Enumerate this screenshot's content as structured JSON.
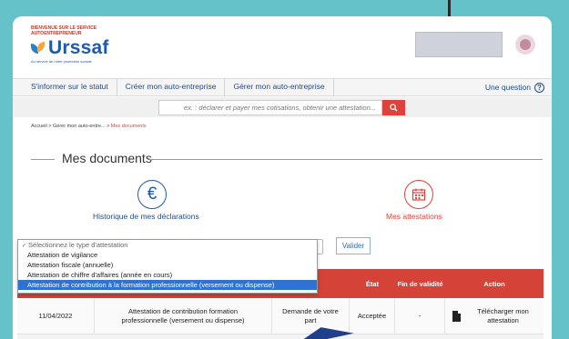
{
  "brand": {
    "small_text": "BIENVENUE SUR LE SERVICE AUTOENTREPRENEUR",
    "name": "Urssaf",
    "tagline": "Au service de notre protection sociale"
  },
  "nav": {
    "items": [
      "S'informer sur le statut",
      "Créer mon auto-entreprise",
      "Gérer mon auto-entreprise"
    ],
    "question": "Une question"
  },
  "search": {
    "placeholder": "ex. : déclarer et payer mes cotisations, obtenir une attestation..."
  },
  "breadcrumb": {
    "items": [
      "Accueil",
      "Gérer mon auto-entre...",
      "Mes documents"
    ]
  },
  "page_title": "Mes documents",
  "cards": {
    "history": "Historique de mes déclarations",
    "attestations": "Mes attestations"
  },
  "dropdown": {
    "placeholder": "Sélectionnez le type d'attestation",
    "options": [
      "Attestation de vigilance",
      "Attestation fiscale (annuelle)",
      "Attestation de chiffre d'affaires (année en cours)",
      "Attestation de contribution à la formation professionnelle (versement ou dispense)"
    ],
    "highlighted_index": 3
  },
  "valider": "Valider",
  "table": {
    "headers": [
      "",
      "",
      "e",
      "État",
      "Fin de validité",
      "Action"
    ],
    "row": {
      "date": "11/04/2022",
      "type": "Attestation de contribution formation professionnelle (versement ou dispense)",
      "request": "Demande de votre part",
      "state": "Acceptée",
      "validity": "-",
      "action": "Télécharger mon attestation"
    }
  },
  "colors": {
    "accent": "#e0413a",
    "brand": "#1e5aa8",
    "background": "#64c2c8",
    "header_row": "#d54237"
  }
}
